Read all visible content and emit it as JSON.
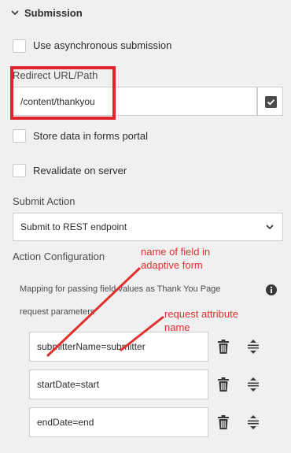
{
  "panel": {
    "section_title": "Submission"
  },
  "options": {
    "async_label": "Use asynchronous submission",
    "store_portal_label": "Store data in forms portal",
    "revalidate_label": "Revalidate on server"
  },
  "redirect": {
    "label": "Redirect URL/Path",
    "value": "/content/thankyou"
  },
  "submit_action": {
    "label": "Submit Action",
    "selected": "Submit to REST endpoint"
  },
  "action_config": {
    "label": "Action Configuration",
    "mapping_desc": "Mapping for passing field values as Thank You Page",
    "mapping_desc_2": "request parameters",
    "rows": [
      {
        "value": "submitterName=submitter"
      },
      {
        "value": "startDate=start"
      },
      {
        "value": "endDate=end"
      }
    ]
  },
  "annotations": {
    "field_name_line1": "name of field in",
    "field_name_line2": "adaptive form",
    "attr_line1": "request attribute",
    "attr_line2": "name"
  },
  "colors": {
    "annotation_red": "#e03030",
    "checkbox_button_bg": "#4b4b4b",
    "panel_bg": "#f0f0f0"
  }
}
